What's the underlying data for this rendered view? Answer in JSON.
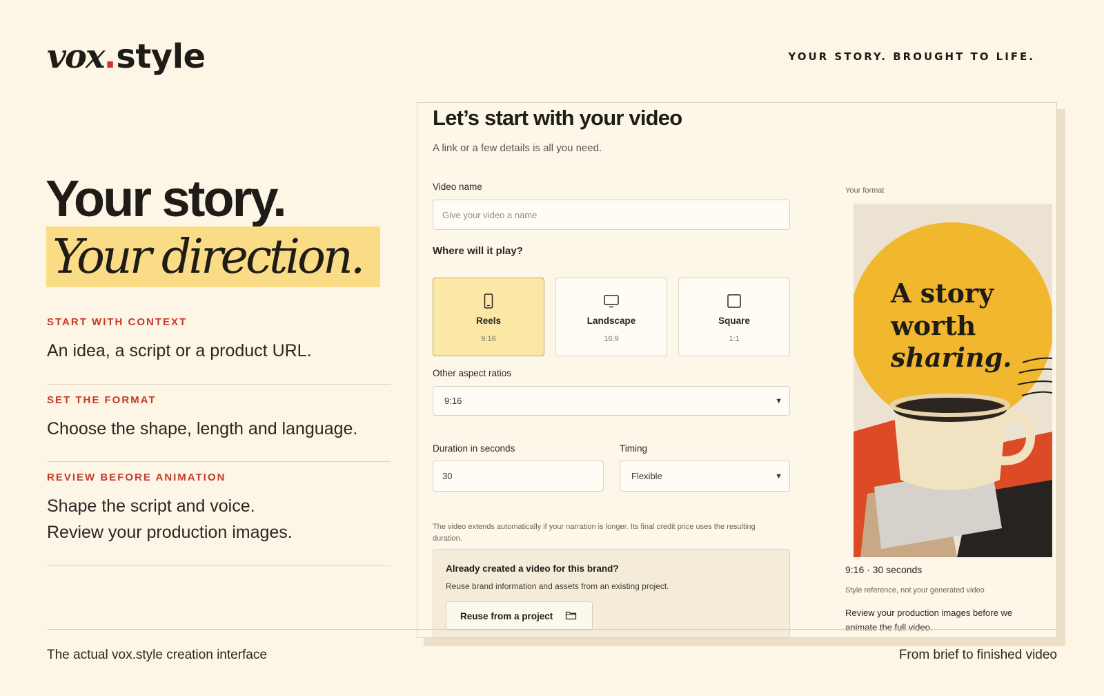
{
  "brand": {
    "logo_main": "vox",
    "logo_dot": ".",
    "logo_suffix": "style",
    "tagline": "YOUR STORY. BROUGHT TO LIFE."
  },
  "hero": {
    "line1": "Your story.",
    "line2": "Your direction."
  },
  "steps": [
    {
      "label": "START WITH CONTEXT",
      "text": "An idea, a script or a product URL."
    },
    {
      "label": "SET THE FORMAT",
      "text": "Choose the shape, length and language."
    },
    {
      "label": "REVIEW BEFORE ANIMATION",
      "text": "Shape the script and voice.",
      "text2": "Review your production images."
    }
  ],
  "footer": {
    "left": "The actual vox.style creation interface",
    "right": "From brief to finished video"
  },
  "form": {
    "title": "Let’s start with your video",
    "subtitle": "A link or a few details is all you need.",
    "video_name_label": "Video name",
    "video_name_placeholder": "Give your video a name",
    "where_label": "Where will it play?",
    "formats": [
      {
        "name": "Reels",
        "ratio": "9:16",
        "icon": "phone-icon",
        "selected": true
      },
      {
        "name": "Landscape",
        "ratio": "16:9",
        "icon": "monitor-icon",
        "selected": false
      },
      {
        "name": "Square",
        "ratio": "1:1",
        "icon": "square-icon",
        "selected": false
      }
    ],
    "other_ratios_label": "Other aspect ratios",
    "other_ratios_value": "9:16",
    "duration_label": "Duration in seconds",
    "duration_value": "30",
    "timing_label": "Timing",
    "timing_value": "Flexible",
    "note": "The video extends automatically if your narration is longer. Its final credit price uses the resulting duration.",
    "reuse_title": "Already created a video for this brand?",
    "reuse_sub": "Reuse brand information and assets from an existing project.",
    "reuse_button": "Reuse from a project"
  },
  "preview": {
    "label": "Your format",
    "poster_line1": "A story",
    "poster_line2": "worth",
    "poster_line3": "sharing.",
    "meta": "9:16 · 30 seconds",
    "reference_note": "Style reference, not your generated video",
    "review_note": "Review your production images before we animate the full video."
  },
  "colors": {
    "background": "#fdf6e7",
    "accent_red": "#c53b2c",
    "highlight_yellow": "#fbdc86",
    "selected_card": "#fbe7a6"
  }
}
